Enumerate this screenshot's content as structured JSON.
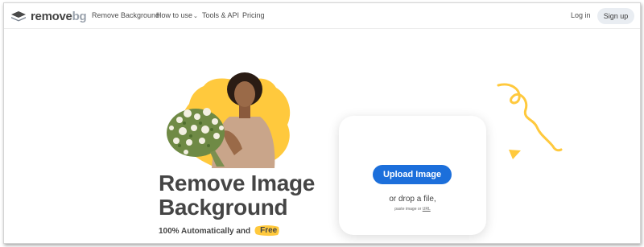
{
  "brand": {
    "name_main": "remove",
    "name_accent": "bg",
    "logo_icon": "stacked-layers-icon"
  },
  "nav": {
    "links": [
      {
        "label": "Remove Background"
      },
      {
        "label": "How to use",
        "icon": "chevron-down-icon"
      },
      {
        "label": "Tools & API"
      },
      {
        "label": "Pricing"
      }
    ],
    "login": "Log in",
    "signup": "Sign up"
  },
  "hero": {
    "title_line1": "Remove Image",
    "title_line2": "Background",
    "subtitle": "100% Automatically and",
    "free_badge": "Free"
  },
  "upload": {
    "button": "Upload Image",
    "drop_text": "or drop a file,",
    "paste_prefix": "paste image or",
    "paste_url": "URL"
  },
  "colors": {
    "accent_blue": "#1c6fdb",
    "accent_yellow": "#ffc93d",
    "text_dark": "#454545",
    "signup_bg": "#e9edf2"
  }
}
